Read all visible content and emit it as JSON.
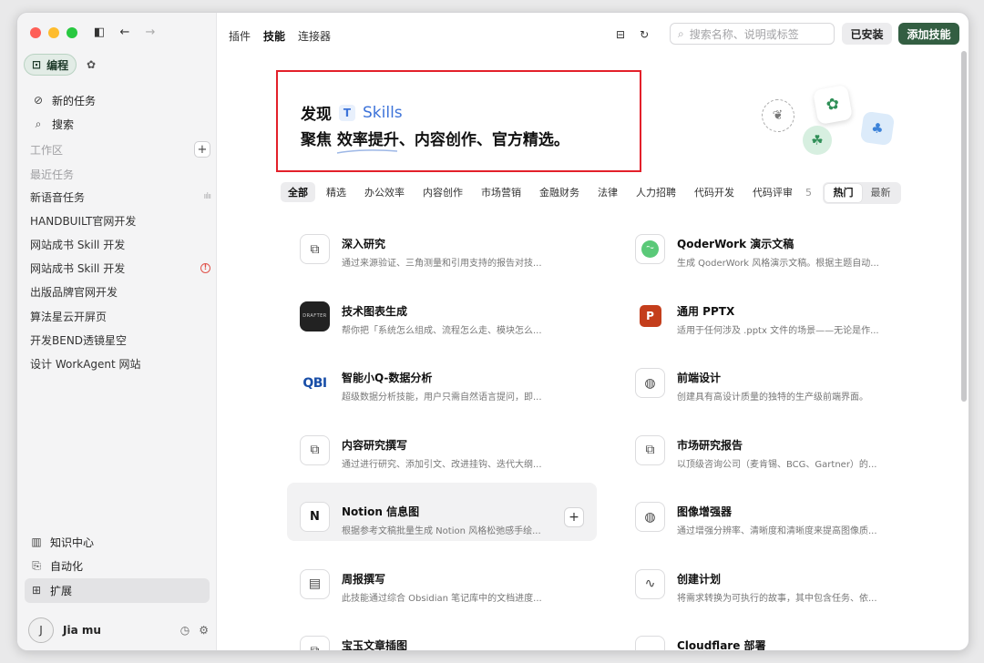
{
  "sidebar": {
    "mode_active": "编程",
    "nav": [
      {
        "label": "新的任务",
        "icon": "new-task-icon"
      },
      {
        "label": "搜索",
        "icon": "search-icon"
      }
    ],
    "workspace_label": "工作区",
    "recent_label": "最近任务",
    "tasks": [
      {
        "label": "新语音任务",
        "flag": "wave"
      },
      {
        "label": "HANDBUILT官网开发",
        "flag": ""
      },
      {
        "label": "网站成书 Skill 开发",
        "flag": ""
      },
      {
        "label": "网站成书 Skill 开发",
        "flag": "warn"
      },
      {
        "label": "出版品牌官网开发",
        "flag": ""
      },
      {
        "label": "算法星云开屏页",
        "flag": ""
      },
      {
        "label": "开发BEND透镜星空",
        "flag": ""
      },
      {
        "label": "设计 WorkAgent 网站",
        "flag": ""
      }
    ],
    "bottom": [
      {
        "label": "知识中心",
        "icon": "book-icon"
      },
      {
        "label": "自动化",
        "icon": "automation-icon"
      },
      {
        "label": "扩展",
        "icon": "extension-icon"
      }
    ],
    "user": {
      "name": "Jia mu",
      "avatar_letter": "J"
    }
  },
  "topbar": {
    "tabs": [
      "插件",
      "技能",
      "连接器"
    ],
    "active_tab": "技能",
    "search_placeholder": "搜索名称、说明或标签",
    "installed_label": "已安装",
    "add_label": "添加技能"
  },
  "hero": {
    "discover": "发现",
    "brand": "Skills",
    "line2": "聚焦 效率提升、内容创作、官方精选。"
  },
  "filters": [
    "全部",
    "精选",
    "办公效率",
    "内容创作",
    "市场营销",
    "金融财务",
    "法律",
    "人力招聘",
    "代码开发",
    "代码评审",
    "5"
  ],
  "active_filter": "全部",
  "sort": {
    "hot": "热门",
    "new": "最新",
    "active": "热门"
  },
  "skills": [
    {
      "title": "深入研究",
      "desc": "通过来源验证、三角测量和引用支持的报告对技...",
      "icon": "puzzle-icon"
    },
    {
      "title": "QoderWork 演示文稿",
      "desc": "生成 QoderWork 风格演示文稿。根据主题自动...",
      "icon": "qoder-icon"
    },
    {
      "title": "技术图表生成",
      "desc": "帮你把「系统怎么组成、流程怎么走、模块怎么...",
      "icon": "drafter-icon"
    },
    {
      "title": "通用 PPTX",
      "desc": "适用于任何涉及 .pptx 文件的场景——无论是作...",
      "icon": "powerpoint-icon"
    },
    {
      "title": "智能小Q-数据分析",
      "desc": "超级数据分析技能，用户只需自然语言提问，即...",
      "icon": "qbi-icon"
    },
    {
      "title": "前端设计",
      "desc": "创建具有高设计质量的独特的生产级前端界面。",
      "icon": "palette-icon"
    },
    {
      "title": "内容研究撰写",
      "desc": "通过进行研究、添加引文、改进挂钩、迭代大纲...",
      "icon": "puzzle-icon"
    },
    {
      "title": "市场研究报告",
      "desc": "以顶级咨询公司（麦肯锡、BCG、Gartner）的...",
      "icon": "puzzle-icon"
    },
    {
      "title": "Notion 信息图",
      "desc": "根据参考文稿批量生成 Notion 风格松弛感手绘...",
      "icon": "notion-icon"
    },
    {
      "title": "图像增强器",
      "desc": "通过增强分辨率、清晰度和清晰度来提高图像质...",
      "icon": "palette-icon"
    },
    {
      "title": "周报撰写",
      "desc": "此技能通过综合 Obsidian 笔记库中的文档进度...",
      "icon": "document-icon"
    },
    {
      "title": "创建计划",
      "desc": "将需求转换为可执行的故事，其中包含任务、依...",
      "icon": "plan-icon"
    },
    {
      "title": "宝玉文章插图",
      "desc": "",
      "icon": "puzzle-icon"
    },
    {
      "title": "Cloudflare 部署",
      "desc": "",
      "icon": "cloud-icon"
    }
  ]
}
